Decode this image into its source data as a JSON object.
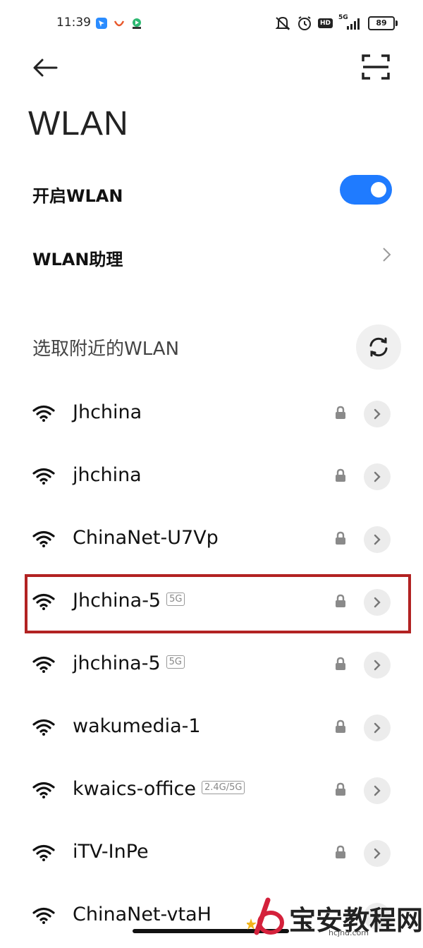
{
  "status_bar": {
    "time": "11:39",
    "network_type": "5G",
    "battery": "89",
    "hd_badge": "HD"
  },
  "header": {
    "title": "WLAN"
  },
  "settings": {
    "wlan_toggle_label": "开启WLAN",
    "wlan_enabled": true,
    "assistant_label": "WLAN助理"
  },
  "section": {
    "nearby_label": "选取附近的WLAN"
  },
  "networks": [
    {
      "name": "Jhchina",
      "badge": "",
      "locked": true
    },
    {
      "name": "jhchina",
      "badge": "",
      "locked": true
    },
    {
      "name": "ChinaNet-U7Vp",
      "badge": "",
      "locked": true
    },
    {
      "name": "Jhchina-5",
      "badge": "5G",
      "locked": true
    },
    {
      "name": "jhchina-5",
      "badge": "5G",
      "locked": true
    },
    {
      "name": "wakumedia-1",
      "badge": "",
      "locked": true
    },
    {
      "name": "kwaics-office",
      "badge": "2.4G/5G",
      "locked": true
    },
    {
      "name": "iTV-InPe",
      "badge": "",
      "locked": true
    },
    {
      "name": "ChinaNet-vtaH",
      "badge": "",
      "locked": false
    }
  ],
  "colors": {
    "accent": "#1f7bff",
    "highlight": "#b22222"
  },
  "watermark": {
    "text": "宝安教程网",
    "url": "hcjhd.com"
  }
}
